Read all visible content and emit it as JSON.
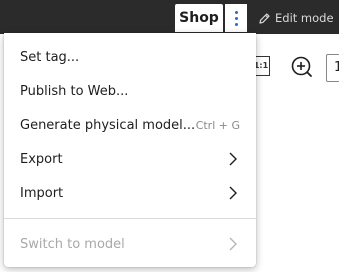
{
  "topbar": {
    "shop_label": "Shop",
    "more_options_icon": "vertical-ellipsis",
    "edit_mode_icon": "pencil-icon",
    "edit_mode_label": "Edit mode"
  },
  "toolbar": {
    "actual_size_label": "1:1",
    "zoom_in_icon": "zoom-in",
    "zoom_value": "1"
  },
  "menu": {
    "items": [
      {
        "label": "Set tag...",
        "shortcut": "",
        "submenu": false,
        "disabled": false
      },
      {
        "label": "Publish to Web...",
        "shortcut": "",
        "submenu": false,
        "disabled": false
      },
      {
        "label": "Generate physical model...",
        "shortcut": "Ctrl + G",
        "submenu": false,
        "disabled": false
      },
      {
        "label": "Export",
        "shortcut": "",
        "submenu": true,
        "disabled": false
      },
      {
        "label": "Import",
        "shortcut": "",
        "submenu": true,
        "disabled": false
      },
      {
        "label": "Switch to model",
        "shortcut": "",
        "submenu": true,
        "disabled": true
      }
    ]
  },
  "colors": {
    "topbar_bg": "#2b2b2b",
    "accent": "#1f6fd1",
    "menu_text": "#1e1e1e",
    "disabled_text": "#a8a8a8",
    "shortcut_text": "#8a8a8a"
  }
}
